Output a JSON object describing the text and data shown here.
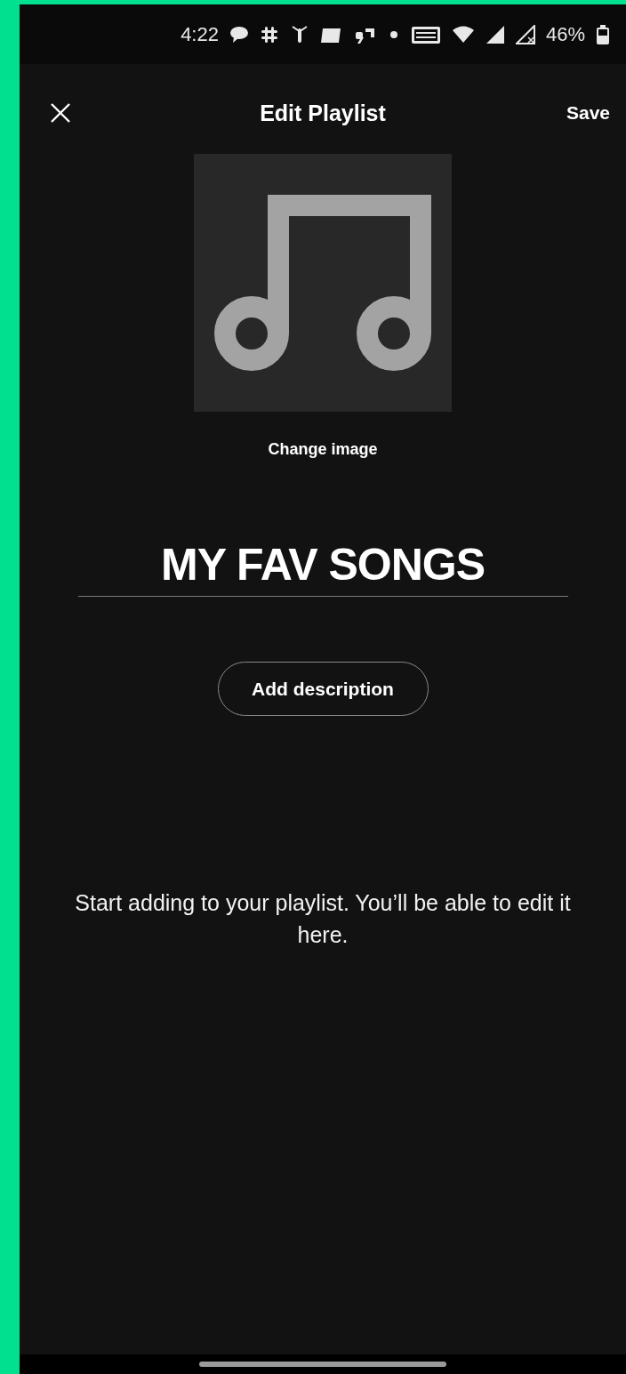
{
  "status_bar": {
    "time": "4:22",
    "battery": "46%"
  },
  "header": {
    "title": "Edit Playlist",
    "save": "Save"
  },
  "cover": {
    "change_label": "Change image"
  },
  "playlist_name": {
    "value": "MY FAV SONGS"
  },
  "description_button": "Add description",
  "empty_message": "Start adding to your playlist. You’ll be able to edit it here."
}
